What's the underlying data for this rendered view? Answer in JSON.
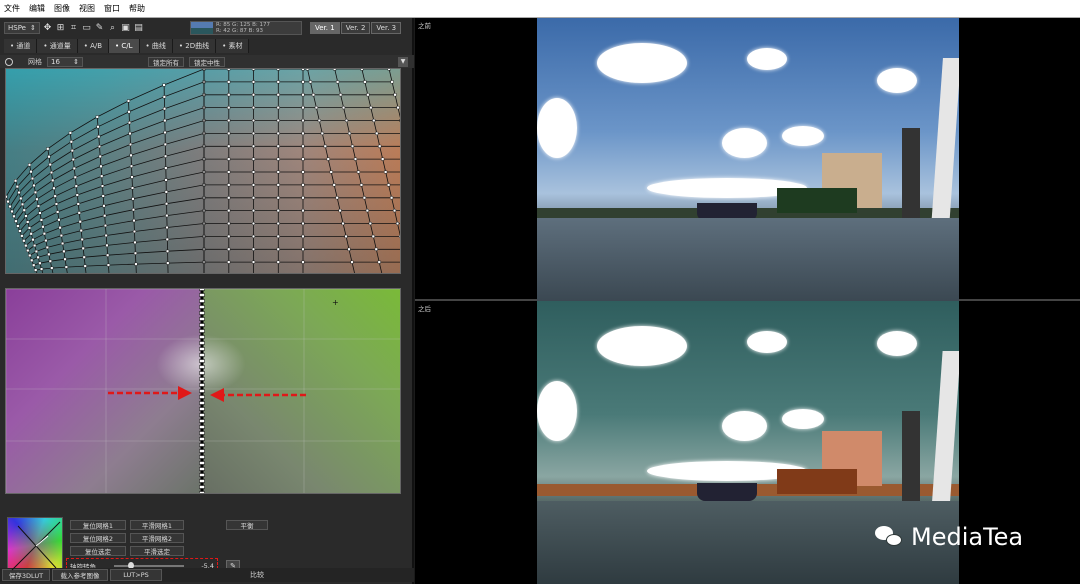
{
  "menu": [
    "文件",
    "编辑",
    "图像",
    "视图",
    "窗口",
    "帮助"
  ],
  "toolbar": {
    "colorspace": "HSPe",
    "readout": {
      "row1": "R: 85   G: 125  B: 177",
      "row2": "R: 42   G: 87   B: 93"
    },
    "versions": [
      "Ver. 1",
      "Ver. 2",
      "Ver. 3"
    ],
    "active_version": "Ver. 1"
  },
  "tabs": [
    "通道",
    "通道量",
    "A/B",
    "C/L",
    "曲线",
    "2D曲线",
    "素材"
  ],
  "active_tab": "C/L",
  "gridbar": {
    "grid_label": "网格",
    "grid_value": "16",
    "lock_all": "锁定所有",
    "lock_neutral": "锁定中性"
  },
  "buttons": {
    "b1": "复位网格1",
    "b2": "平滑网格1",
    "b3": "复位网格2",
    "b4": "平滑网格2",
    "b5": "复位选定",
    "b6": "平滑选定",
    "balance": "平衡"
  },
  "slider": {
    "label": "轴旋转角",
    "value_label": "-5.4",
    "value_fraction": 0.22
  },
  "bottom": {
    "save_lut": "保存3DLUT",
    "load_image": "载入参考图像",
    "lut_ps": "LUT>PS",
    "compare": "比较"
  },
  "viewports": {
    "before_label": "之前",
    "after_label": "之后"
  },
  "watermark": "MediaTea",
  "colors": {
    "accent_red": "#e01818",
    "watermark": "#ffffff"
  }
}
